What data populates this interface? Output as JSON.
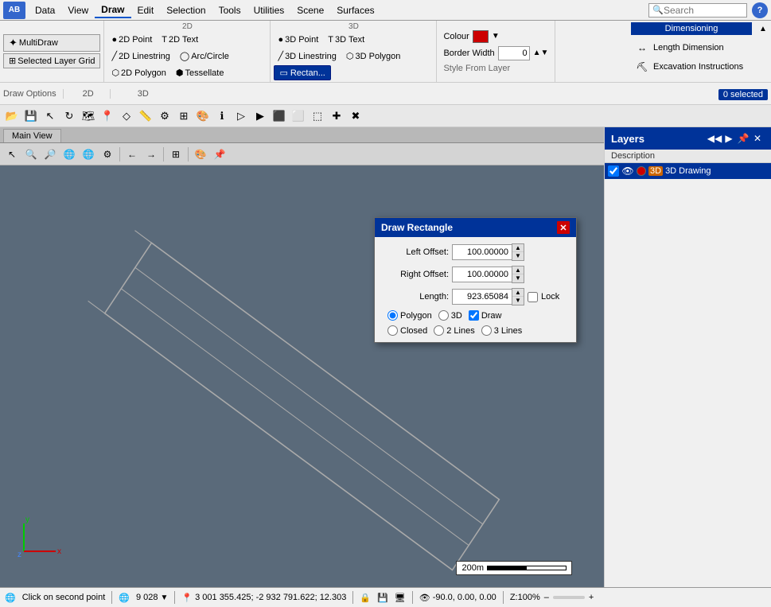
{
  "menubar": {
    "logo_text": "AB",
    "items": [
      {
        "label": "Data",
        "active": false
      },
      {
        "label": "View",
        "active": false
      },
      {
        "label": "Draw",
        "active": true
      },
      {
        "label": "Edit",
        "active": false
      },
      {
        "label": "Selection",
        "active": false
      },
      {
        "label": "Tools",
        "active": false
      },
      {
        "label": "Utilities",
        "active": false
      },
      {
        "label": "Scene",
        "active": false
      },
      {
        "label": "Surfaces",
        "active": false
      }
    ],
    "search_placeholder": "Search",
    "help_label": "?"
  },
  "toolbar1": {
    "color_label": "Colour",
    "border_width_label": "Border Width",
    "border_width_value": "0",
    "style_from_layer_label": "Style From Layer",
    "buttons_2d": [
      {
        "label": "2D Point",
        "icon": "●"
      },
      {
        "label": "2D Linestring",
        "icon": "╱"
      },
      {
        "label": "2D Polygon",
        "icon": "⬡"
      },
      {
        "label": "2D Text",
        "icon": "T"
      },
      {
        "label": "Arc/Circle",
        "icon": "◯"
      },
      {
        "label": "Tessellate",
        "icon": "⬢"
      }
    ],
    "buttons_3d": [
      {
        "label": "3D Point",
        "icon": "●"
      },
      {
        "label": "3D Linestring",
        "icon": "╱"
      },
      {
        "label": "3D Polygon",
        "icon": "⬡"
      },
      {
        "label": "3D Text",
        "icon": "T"
      }
    ],
    "rect_label": "Rectan...",
    "dim_section_title": "Dimensioning",
    "dim_buttons": [
      {
        "label": "Length Dimension",
        "icon": "↔"
      },
      {
        "label": "Excavation Instructions",
        "icon": "⛏"
      }
    ]
  },
  "toolbar2": {
    "section_2d": "2D",
    "section_3d": "3D",
    "draw_options": "Draw Options",
    "selected_count": "0 selected"
  },
  "multidraw": {
    "label": "MultiDraw"
  },
  "selected_layer_grid": {
    "label": "Selected Layer Grid"
  },
  "canvas": {
    "tab_label": "Main View",
    "view_buttons": [
      "🔍",
      "🔎",
      "🌐",
      "🌐",
      "⚙",
      "←",
      "→",
      "⊞",
      "🎨",
      "📌"
    ],
    "scale_text": "200m",
    "coords": "3 001 355.425; -2 932 791.622; 12.303",
    "rotation": "-90.0, 0.00, 0.00",
    "zoom": "Z:100%"
  },
  "dialog": {
    "title": "Draw Rectangle",
    "left_offset_label": "Left Offset:",
    "left_offset_value": "100.00000",
    "right_offset_label": "Right Offset:",
    "right_offset_value": "100.00000",
    "length_label": "Length:",
    "length_value": "923.65084",
    "lock_label": "Lock",
    "polygon_label": "Polygon",
    "3d_label": "3D",
    "draw_label": "Draw",
    "closed_label": "Closed",
    "2lines_label": "2 Lines",
    "3lines_label": "3 Lines"
  },
  "layers": {
    "title": "Layers",
    "description_col": "Description",
    "items": [
      {
        "name": "3D Drawing",
        "visible": true,
        "locked": false,
        "color": "#cc0000",
        "selected": true
      }
    ]
  },
  "statusbar": {
    "click_text": "Click on second point",
    "coordinate_number": "9 028",
    "coordinates": "3 001 355.425; -2 932 791.622; 12.303",
    "rotation": "-90.0, 0.00, 0.00",
    "zoom": "Z:100%",
    "zoom_value": "Z:100%",
    "minus": "–",
    "plus": "+"
  }
}
